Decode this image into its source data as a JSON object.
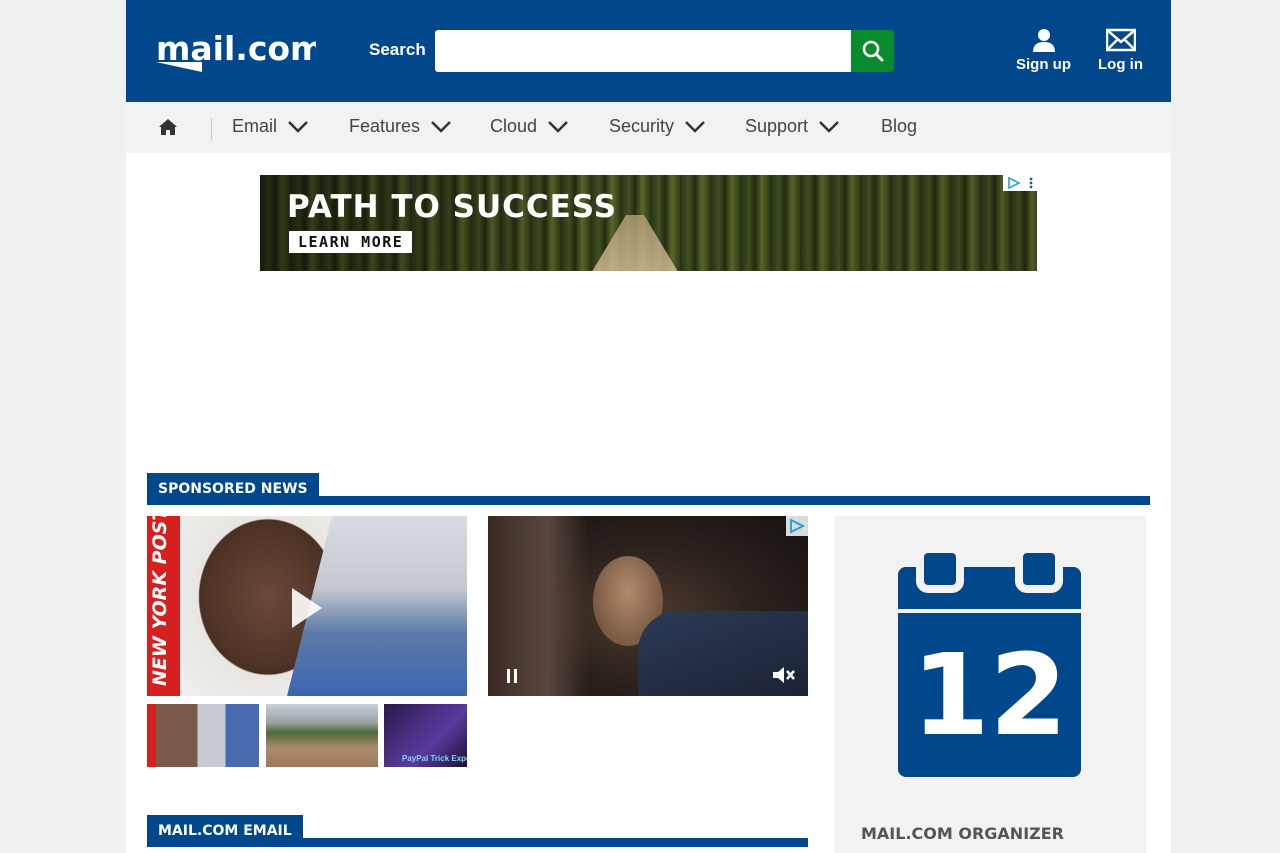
{
  "header": {
    "logo_text": "mail.com",
    "search_label": "Search",
    "search_placeholder": "",
    "signup_label": "Sign up",
    "login_label": "Log in"
  },
  "nav": {
    "items": [
      {
        "label": "Email",
        "dropdown": true
      },
      {
        "label": "Features",
        "dropdown": true
      },
      {
        "label": "Cloud",
        "dropdown": true
      },
      {
        "label": "Security",
        "dropdown": true
      },
      {
        "label": "Support",
        "dropdown": true
      },
      {
        "label": "Blog",
        "dropdown": false
      }
    ]
  },
  "ad": {
    "headline": "PATH TO SUCCESS",
    "cta": "LEARN MORE"
  },
  "sponsored": {
    "heading": "SPONSORED NEWS",
    "video_brand": "NEW YORK POST",
    "thumb3_caption": "PayPal Trick Expos"
  },
  "email_section": {
    "heading": "MAIL.COM EMAIL"
  },
  "organizer": {
    "day": "12",
    "title": "MAIL.COM ORGANIZER"
  },
  "colors": {
    "brand_blue": "#01478c",
    "search_green": "#0a8a2f",
    "nav_bg": "#f2f2f2"
  }
}
